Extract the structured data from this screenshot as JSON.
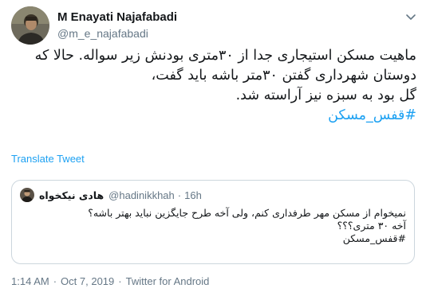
{
  "author": {
    "name": "M Enayati Najafabadi",
    "handle": "@m_e_najafabadi"
  },
  "tweet": {
    "lines": [
      "ماهیت مسکن استیجاری جدا از ۳۰متری بودنش زیر سواله. حالا که",
      "دوستان شهرداری گفتن ۳۰متر باشه باید گفت،",
      "گل بود به سبزه نیز آراسته شد."
    ],
    "hashtag": "#قفس_مسکن"
  },
  "translate_label": "Translate Tweet",
  "quoted": {
    "name": "هادی نیکخواه",
    "handle": "@hadinikkhah",
    "separator": "·",
    "time": "16h",
    "lines": [
      "نمیخوام از مسکن مهر طرفداری کنم، ولی آخه طرح جایگزین نباید بهتر باشه؟",
      "آخه ۳۰ متری؟؟؟",
      "#قفس_مسکن"
    ]
  },
  "meta": {
    "time": "1:14 AM",
    "separator": "·",
    "date": "Oct 7, 2019",
    "source": "Twitter for Android"
  },
  "colors": {
    "link": "#1da1f2",
    "secondary": "#657786",
    "border": "#ccd6dd"
  },
  "icons": {
    "caret": "chevron-down-icon"
  }
}
